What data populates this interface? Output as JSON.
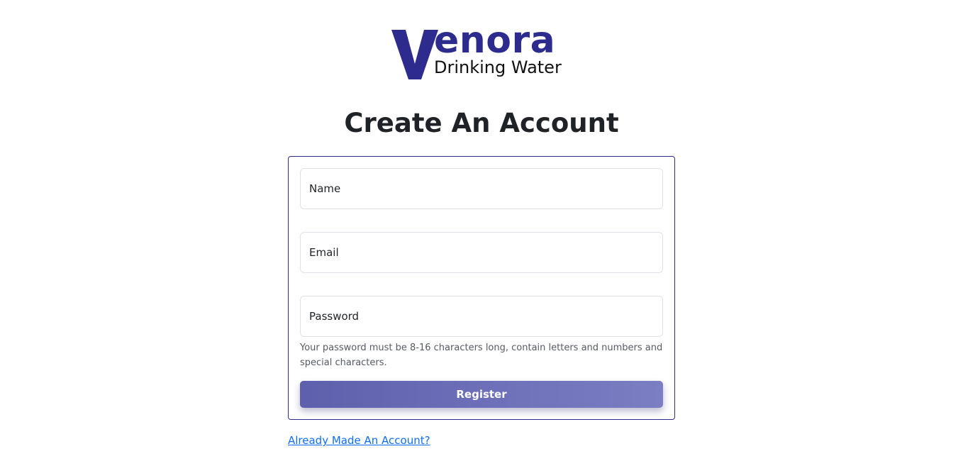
{
  "brand": {
    "logo_letter": "V",
    "logo_word": "enora",
    "tagline": "Drinking Water",
    "color": "#2e2b8f"
  },
  "page_title": "Create An Account",
  "form": {
    "name_placeholder": "Name",
    "name_value": "",
    "email_placeholder": "Email",
    "email_value": "",
    "password_placeholder": "Password",
    "password_value": "",
    "password_hint": "Your password must be 8-16 characters long, contain letters and numbers and special characters.",
    "register_label": "Register",
    "register_color": "#6e70b9"
  },
  "login_link": "Already Made An Account?",
  "link_color": "#0d6efd"
}
